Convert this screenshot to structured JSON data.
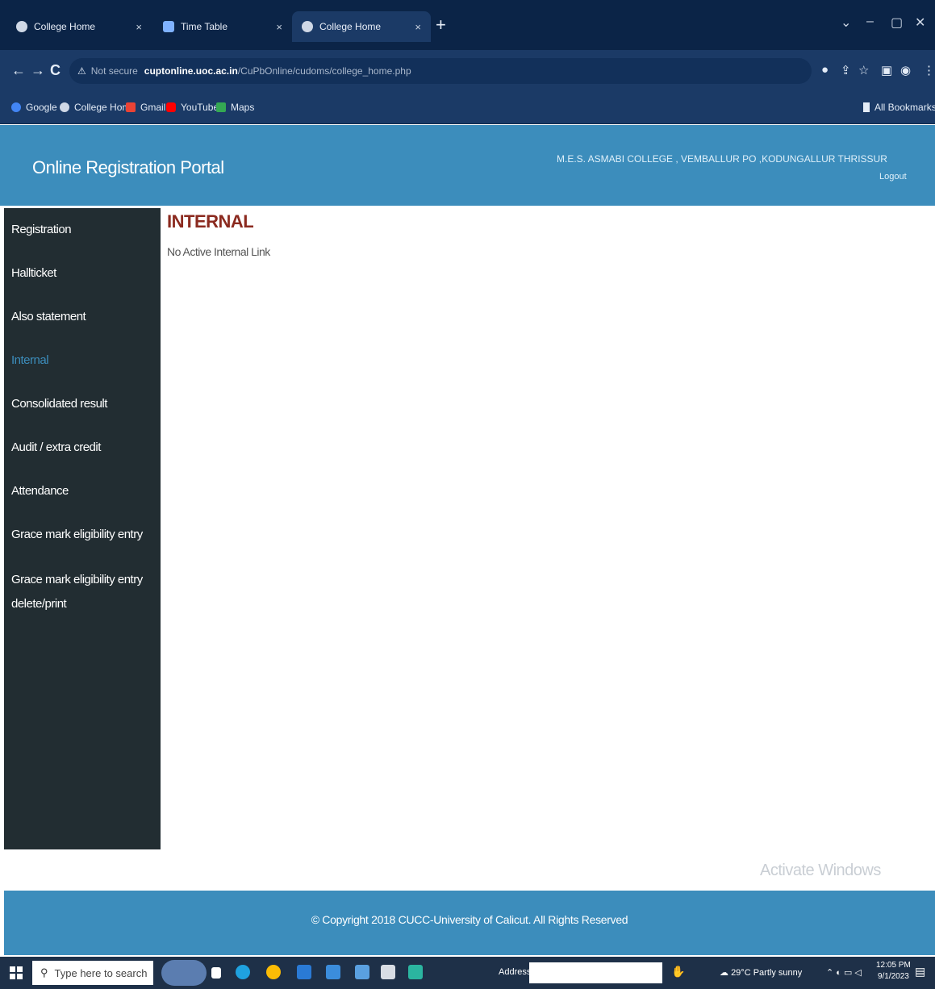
{
  "browser": {
    "tabs": [
      {
        "label": "College Home",
        "close": "×"
      },
      {
        "label": "Time Table",
        "close": "×"
      },
      {
        "label": "College Home",
        "close": "×"
      }
    ],
    "new_tab": "+",
    "window_controls": [
      "⌄",
      "–",
      "▢",
      "✕"
    ],
    "nav": {
      "back": "←",
      "forward": "→",
      "reload": "C"
    },
    "address": {
      "warning": "⚠",
      "security_label": "Not secure",
      "host": "cuptonline.uoc.ac.in",
      "path": "/CuPbOnline/cudoms/college_home.php"
    },
    "bookmarks": [
      {
        "label": "Google",
        "color": "#4285f4"
      },
      {
        "label": "College Home",
        "color": "#cfd8e6"
      },
      {
        "label": "Gmail",
        "color": "#ea4335"
      },
      {
        "label": "YouTube",
        "color": "#ff0000"
      },
      {
        "label": "Maps",
        "color": "#34a853"
      }
    ],
    "all_bookmarks": "All Bookmarks"
  },
  "header": {
    "brand": "Online Registration Portal",
    "college": "M.E.S. ASMABI COLLEGE , VEMBALLUR PO ,KODUNGALLUR THRISSUR",
    "logout": "Logout"
  },
  "sidebar": {
    "items": [
      {
        "label": "Registration"
      },
      {
        "label": "Hallticket"
      },
      {
        "label": "Also statement"
      },
      {
        "label": "Internal"
      },
      {
        "label": "Consolidated result"
      },
      {
        "label": "Audit / extra credit"
      },
      {
        "label": "Attendance"
      },
      {
        "label": "Grace mark eligibility entry"
      },
      {
        "label": "Grace mark eligibility entry delete/print"
      }
    ],
    "active_index": 3
  },
  "main": {
    "title": "INTERNAL",
    "message": "No Active Internal Link"
  },
  "watermark": "Activate Windows",
  "footer": {
    "copyright": "© Copyright 2018 CUCC-University of Calicut. All Rights Reserved"
  },
  "taskbar": {
    "search_placeholder": "Type here to search",
    "address_label": "Address",
    "weather": "29°C Partly sunny",
    "time": "12:05 PM",
    "date": "9/1/2023"
  },
  "colors": {
    "header": "#3c8dbc",
    "sidebar": "#222d32",
    "title": "#8b2a1f",
    "browser_frame": "#1b3a66"
  }
}
